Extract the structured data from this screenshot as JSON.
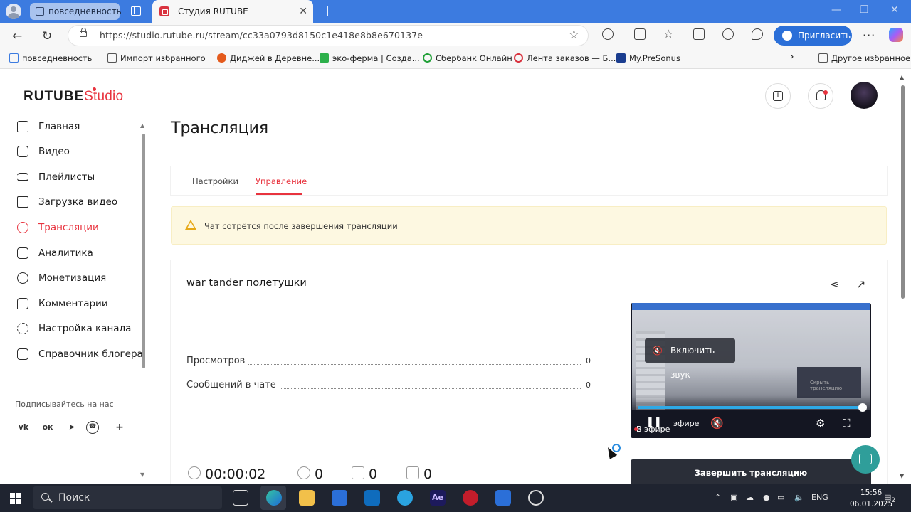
{
  "browser": {
    "workspace_tab": "повседневность",
    "active_tab": "Студия RUTUBE",
    "url": "https://studio.rutube.ru/stream/cc33a0793d8150c1e418e8b8e670137e",
    "invite_label": "Пригласить",
    "bookmarks": [
      "повседневность",
      "Импорт избранного",
      "Диджей в Деревне...",
      "эко-ферма | Созда...",
      "Сбербанк Онлайн",
      "Лента заказов — Б...",
      "My.PreSonus"
    ],
    "other_bookmarks": "Другое избранное"
  },
  "app": {
    "logo_main": "RUTUBE",
    "logo_studio": "Studio",
    "sidebar": {
      "items": [
        {
          "label": "Главная",
          "icon": "home-icon"
        },
        {
          "label": "Видео",
          "icon": "video-icon"
        },
        {
          "label": "Плейлисты",
          "icon": "playlist-icon"
        },
        {
          "label": "Загрузка видео",
          "icon": "upload-icon"
        },
        {
          "label": "Трансляции",
          "icon": "broadcast-icon",
          "active": true
        },
        {
          "label": "Аналитика",
          "icon": "analytics-icon"
        },
        {
          "label": "Монетизация",
          "icon": "ruble-icon"
        },
        {
          "label": "Комментарии",
          "icon": "comment-icon"
        },
        {
          "label": "Настройка канала",
          "icon": "gear-icon"
        },
        {
          "label": "Справочник блогера",
          "icon": "help-icon"
        }
      ],
      "follow_label": "Подписывайтесь на нас",
      "socials": [
        "vk",
        "ok",
        "telegram",
        "viber",
        "more"
      ]
    },
    "page_title": "Трансляция",
    "tabs": [
      "Настройки",
      "Управление"
    ],
    "active_tab_index": 1,
    "warning": "Чат сотрётся после завершения трансляции",
    "stream": {
      "title": "war tander полетушки",
      "stats": [
        {
          "label": "Просмотров",
          "value": "0"
        },
        {
          "label": "Сообщений в чате",
          "value": "0"
        }
      ],
      "duration": "00:00:02",
      "viewers": "0",
      "likes": "0",
      "dislikes": "0",
      "end_button": "Завершить трансляцию"
    },
    "player": {
      "unmute_label": "Включить звук",
      "live_label": "В эфире",
      "live_label_overlay": "эфире",
      "progress": 1.0,
      "preview_box_text": "Скрыть трансляцию"
    }
  },
  "taskbar": {
    "search_label": "Поиск",
    "lang": "ENG",
    "time": "15:56",
    "date": "06.01.2025",
    "notif_count": "2"
  },
  "colors": {
    "accent": "#e8333e",
    "titlebar": "#3c7be0",
    "taskbar": "#1f2430",
    "end_button": "#2a2e38"
  }
}
